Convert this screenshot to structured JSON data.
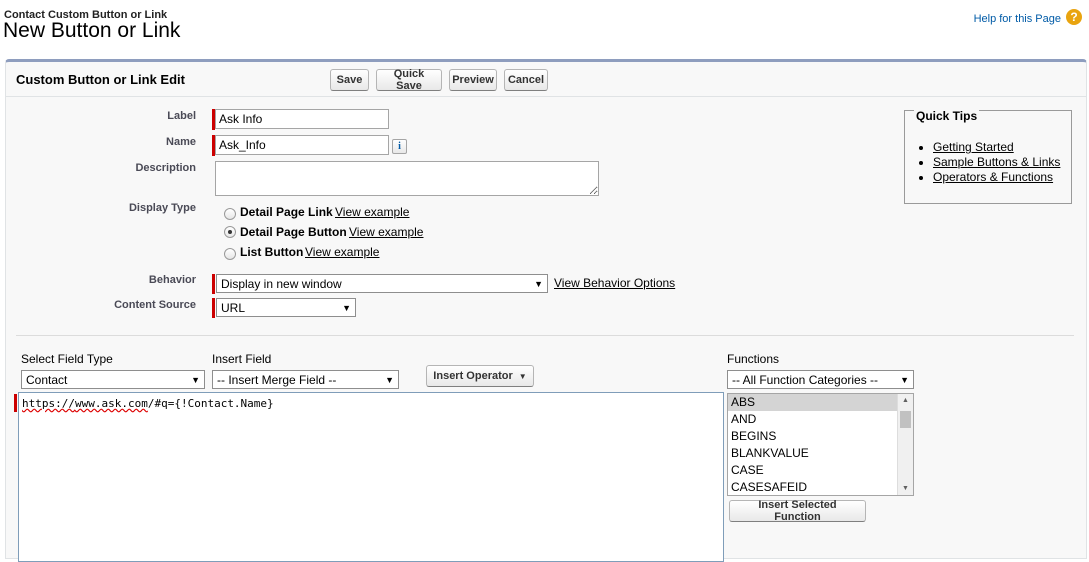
{
  "page": {
    "breadcrumb": "Contact Custom Button or Link",
    "title": "New Button or Link",
    "help_link": "Help for this Page",
    "help_icon": "?"
  },
  "panel": {
    "title": "Custom Button or Link Edit",
    "buttons": {
      "save": "Save",
      "quick_save": "Quick Save",
      "preview": "Preview",
      "cancel": "Cancel"
    }
  },
  "form": {
    "label": {
      "label": "Label",
      "value": "Ask Info"
    },
    "name": {
      "label": "Name",
      "value": "Ask_Info",
      "info": "i"
    },
    "description": {
      "label": "Description",
      "value": ""
    },
    "display_type": {
      "label": "Display Type",
      "options": [
        {
          "label": "Detail Page Link",
          "link": "View example",
          "selected": false
        },
        {
          "label": "Detail Page Button",
          "link": "View example",
          "selected": true
        },
        {
          "label": "List Button",
          "link": "View example",
          "selected": false
        }
      ]
    },
    "behavior": {
      "label": "Behavior",
      "value": "Display in new window",
      "link": "View Behavior Options"
    },
    "content_source": {
      "label": "Content Source",
      "value": "URL"
    }
  },
  "quick_tips": {
    "title": "Quick Tips",
    "items": [
      "Getting Started",
      "Sample Buttons & Links",
      "Operators & Functions"
    ]
  },
  "editor": {
    "select_field_type": {
      "label": "Select Field Type",
      "value": "Contact"
    },
    "insert_field": {
      "label": "Insert Field",
      "value": "-- Insert Merge Field --"
    },
    "insert_operator": "Insert Operator",
    "formula_prefix": "https://",
    "formula_host": "www.ask.com",
    "formula_rest": "/#q={!Contact.Name}",
    "functions": {
      "label": "Functions",
      "category": "-- All Function Categories --",
      "items": [
        "ABS",
        "AND",
        "BEGINS",
        "BLANKVALUE",
        "CASE",
        "CASESAFEID"
      ],
      "insert_button": "Insert Selected Function"
    }
  },
  "colors": {
    "accent": "#8e9dbe",
    "required": "#cc0000",
    "help": "#e9a40f",
    "link": "#015ba7"
  }
}
